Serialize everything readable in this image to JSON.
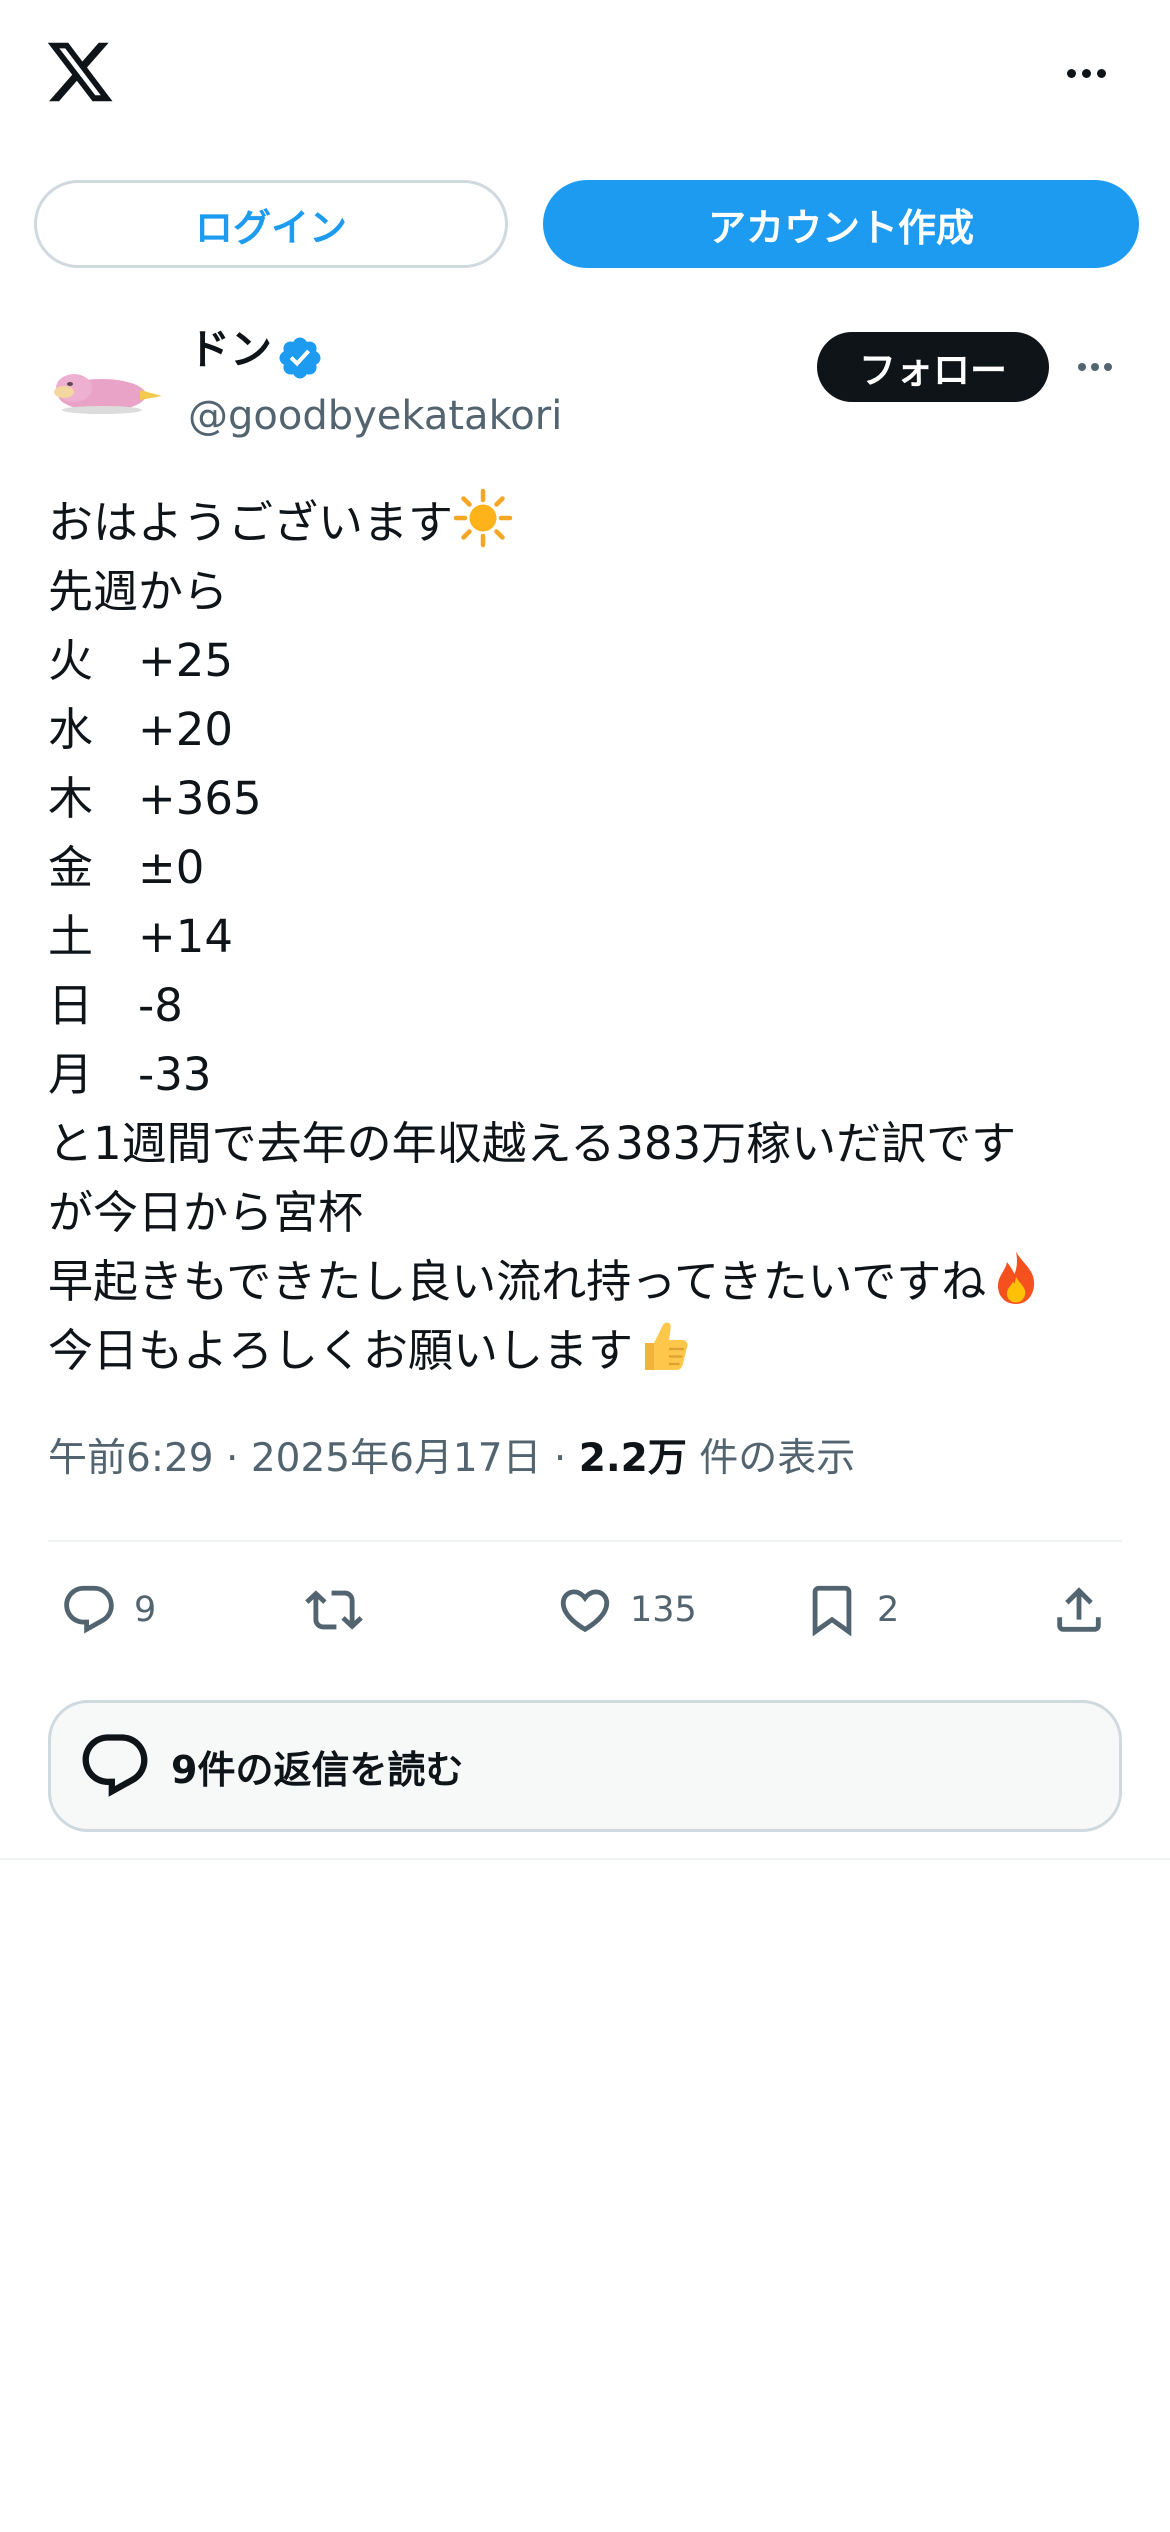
{
  "header": {
    "logo_icon": "x-logo-icon",
    "more_icon": "more-horizontal-icon"
  },
  "auth": {
    "login_label": "ログイン",
    "signup_label": "アカウント作成"
  },
  "post": {
    "author": {
      "display_name": "ドン",
      "verified_icon": "verified-badge-icon",
      "handle": "@goodbyekatakori"
    },
    "follow_label": "フォロー",
    "lines": [
      "おはようございます",
      "先週から",
      "火　+25",
      "水　+20",
      "木　+365",
      "金　±0",
      "土　+14",
      "日　-8",
      "月　-33",
      "と1週間で去年の年収越える383万稼いだ訳です",
      "が今日から宮杯",
      "早起きもできたし良い流れ持ってきたいですね",
      "今日もよろしくお願いします"
    ],
    "meta": {
      "time": "午前6:29",
      "separator": "·",
      "date": "2025年6月17日",
      "views": "2.2万",
      "views_label": "件の表示"
    },
    "actions": {
      "reply_count": "9",
      "repost_count": "",
      "like_count": "135",
      "bookmark_count": "2"
    },
    "read_replies_label": "9件の返信を読む"
  },
  "colors": {
    "accent": "#1d9bf0",
    "text": "#0f1419",
    "secondary": "#536471",
    "border": "#cfd9de"
  }
}
